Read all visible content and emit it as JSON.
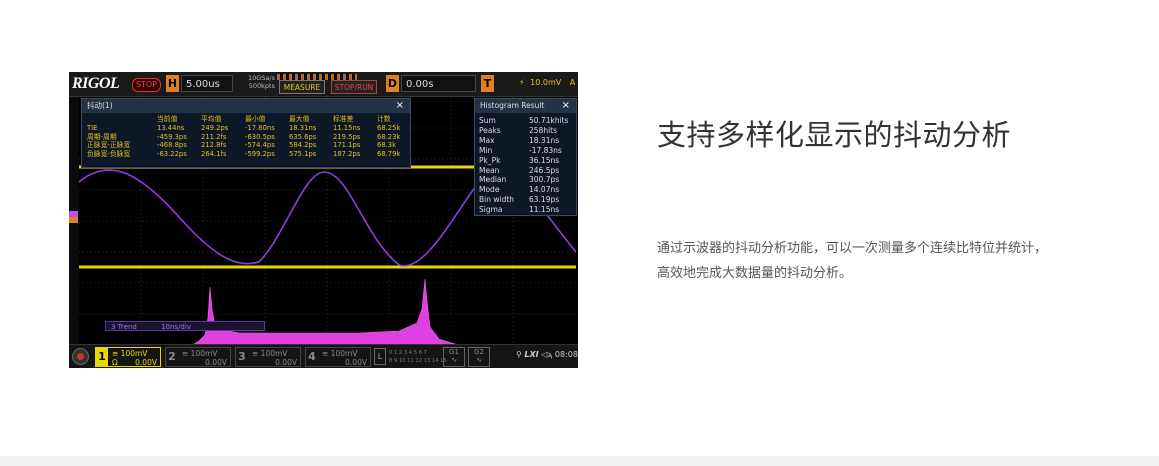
{
  "scope": {
    "logo": "RIGOL",
    "run_state": "STOP",
    "horizontal": {
      "key": "H",
      "timebase": "5.00us",
      "sample_rate": "10GSa/s",
      "memory": "500kpts"
    },
    "buttons": {
      "measure": "MEASURE",
      "stop_run": "STOP/RUN"
    },
    "delay": {
      "key": "D",
      "value": "0.00s"
    },
    "trigger": {
      "key": "T",
      "level": "10.0mV",
      "source": "A"
    },
    "jitter_panel": {
      "title": "抖动(1)",
      "close": "×",
      "columns": [
        "",
        "当前值",
        "平均值",
        "最小值",
        "最大值",
        "标准差",
        "计数"
      ],
      "rows": [
        [
          "TIE",
          "13.44ns",
          "249.2ps",
          "-17.80ns",
          "18.31ns",
          "11.15ns",
          "68.25k"
        ],
        [
          "周期-周期",
          "-459.3ps",
          "211.2fs",
          "-630.5ps",
          "635.6ps",
          "219.5ps",
          "68.23k"
        ],
        [
          "正脉宽-正脉宽",
          "-468.8ps",
          "212.8fs",
          "-574.4ps",
          "584.2ps",
          "171.1ps",
          "68.3k"
        ],
        [
          "负脉宽-负脉宽",
          "-63.22ps",
          "264.1fs",
          "-599.2ps",
          "575.1ps",
          "187.2ps",
          "68.79k"
        ]
      ]
    },
    "histogram_panel": {
      "title": "Histogram Result",
      "close": "×",
      "rows": [
        {
          "k": "Sum",
          "v": "50.71khits"
        },
        {
          "k": "Peaks",
          "v": "258hits"
        },
        {
          "k": "Max",
          "v": "18.31ns"
        },
        {
          "k": "Min",
          "v": "-17.83ns"
        },
        {
          "k": "Pk_Pk",
          "v": "36.15ns"
        },
        {
          "k": "Mean",
          "v": "246.5ps"
        },
        {
          "k": "Median",
          "v": "300.7ps"
        },
        {
          "k": "Mode",
          "v": "14.07ns"
        },
        {
          "k": "Bin width",
          "v": "63.19ps"
        },
        {
          "k": "Sigma",
          "v": "11.15ns"
        }
      ]
    },
    "trend": {
      "label": "3 Trend",
      "scale": "10ns/div"
    },
    "channels": [
      {
        "n": "1",
        "scale": "100mV",
        "coupling": "Ω",
        "offset": "0.00V"
      },
      {
        "n": "2",
        "scale": "100mV",
        "coupling": "",
        "offset": "0.00V"
      },
      {
        "n": "3",
        "scale": "100mV",
        "coupling": "",
        "offset": "0.00V"
      },
      {
        "n": "4",
        "scale": "100mV",
        "coupling": "",
        "offset": "0.00V"
      }
    ],
    "la": {
      "key": "L",
      "row1": "0 1 2 3  4 5 6 7",
      "row2": "8 9 10 11 12 13 14 15"
    },
    "gen": [
      "G1",
      "G2"
    ],
    "status": {
      "lxi": "LXI",
      "time": "08:08"
    },
    "colors": {
      "ch1": "#e6d800",
      "ch2": "#c050e8",
      "trend": "#6a40c0",
      "accent": "#e08020"
    }
  },
  "content": {
    "title": "支持多样化显示的抖动分析",
    "description": "通过示波器的抖动分析功能，可以一次测量多个连续比特位并统计，高效地完成大数据量的抖动分析。"
  }
}
